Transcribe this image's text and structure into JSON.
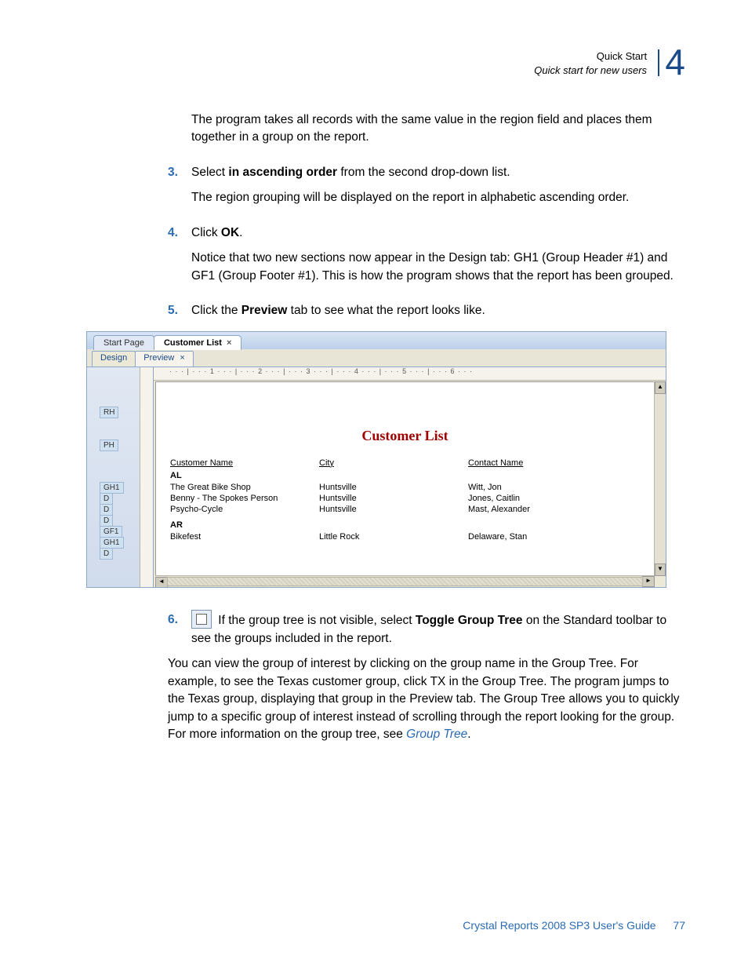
{
  "header": {
    "title": "Quick Start",
    "subtitle": "Quick start for new users",
    "chapter": "4"
  },
  "intro": "The program takes all records with the same value in the region field and places them together in a group on the report.",
  "steps": {
    "three": {
      "num": "3.",
      "pre": "Select ",
      "bold": "in ascending order",
      "post": " from the second drop-down list."
    },
    "three_sub": "The region grouping will be displayed on the report in alphabetic ascending order.",
    "four": {
      "num": "4.",
      "pre": "Click ",
      "bold": "OK",
      "post": "."
    },
    "four_sub": "Notice that two new sections now appear in the Design tab: GH1 (Group Header #1) and GF1 (Group Footer #1). This is how the program shows that the report has been grouped.",
    "five": {
      "num": "5.",
      "pre": "Click the ",
      "bold": "Preview",
      "post": " tab to see what the report looks like."
    },
    "six": {
      "num": "6.",
      "pre": " If the group tree is not visible, select ",
      "bold": "Toggle Group Tree",
      "post": " on the Standard toolbar to see the groups included in the report."
    }
  },
  "screenshot": {
    "tab_inactive": "Start Page",
    "tab_active": "Customer List",
    "subtab_design": "Design",
    "subtab_preview": "Preview",
    "ruler": "· · · | · · · 1 · · · | · · · 2 · · · | · · · 3 · · · | · · · 4 · · · | · · · 5 · · · | · · · 6 · · ·",
    "sections": {
      "rh": "RH",
      "ph": "PH",
      "gh1": "GH1",
      "d": "D",
      "gf1": "GF1"
    },
    "title": "Customer List",
    "columns": {
      "c1": "Customer Name",
      "c2": "City",
      "c3": "Contact Name"
    },
    "group_AL": "AL",
    "rows_AL": [
      {
        "c1": "The Great Bike Shop",
        "c2": "Huntsville",
        "c3": "Witt, Jon"
      },
      {
        "c1": "Benny - The Spokes Person",
        "c2": "Huntsville",
        "c3": "Jones, Caitlin"
      },
      {
        "c1": "Psycho-Cycle",
        "c2": "Huntsville",
        "c3": "Mast, Alexander"
      }
    ],
    "group_AR": "AR",
    "rows_AR": [
      {
        "c1": "Bikefest",
        "c2": "Little Rock",
        "c3": "Delaware, Stan"
      }
    ]
  },
  "para_after": {
    "text": "You can view the group of interest by clicking on the group name in the Group Tree. For example, to see the Texas customer group, click TX in the Group Tree. The program jumps to the Texas group, displaying that group in the Preview tab. The Group Tree allows you to quickly jump to a specific group of interest instead of scrolling through the report looking for the group. For more information on the group tree, see ",
    "link": "Group Tree",
    "tail": "."
  },
  "footer": {
    "doc": "Crystal Reports 2008 SP3 User's Guide",
    "page": "77"
  }
}
